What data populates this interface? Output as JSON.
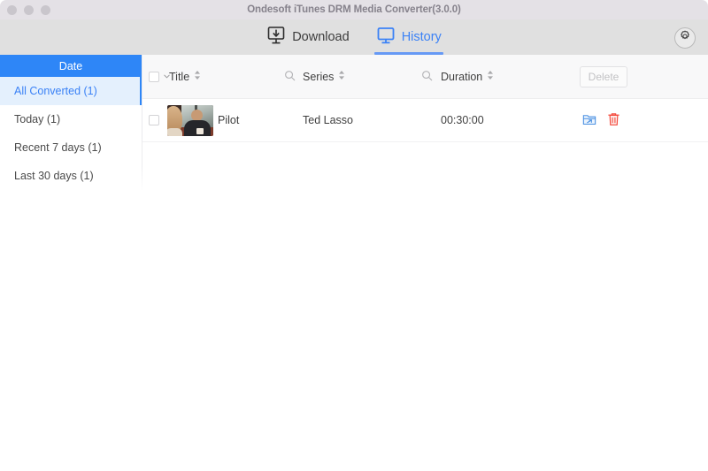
{
  "window": {
    "title": "Ondesoft iTunes DRM Media Converter(3.0.0)",
    "traffic_lights": [
      "close-button",
      "minimize-button",
      "maximize-button"
    ]
  },
  "toolbar": {
    "tabs": [
      {
        "label": "Download",
        "icon": "download-monitor-icon",
        "active": false
      },
      {
        "label": "History",
        "icon": "monitor-icon",
        "active": true
      }
    ],
    "settings_icon": "gear-icon"
  },
  "sidebar": {
    "header": "Date",
    "items": [
      {
        "label": "All Converted (1)",
        "selected": true
      },
      {
        "label": "Today (1)",
        "selected": false
      },
      {
        "label": "Recent 7 days (1)",
        "selected": false
      },
      {
        "label": "Last 30 days (1)",
        "selected": false
      }
    ]
  },
  "table": {
    "select_all_checkbox": false,
    "columns": [
      {
        "key": "title",
        "label": "Title",
        "sortable": true,
        "searchable": false
      },
      {
        "key": "series",
        "label": "Series",
        "sortable": true,
        "searchable": true
      },
      {
        "key": "duration",
        "label": "Duration",
        "sortable": true,
        "searchable": true
      }
    ],
    "delete_button": {
      "label": "Delete",
      "enabled": false
    },
    "search_icon": "search-icon",
    "sort_icon": "sort-arrows-icon",
    "dropdown_icon": "chevron-down-icon",
    "rows": [
      {
        "checked": false,
        "thumbnail": "video-thumbnail",
        "title": "Pilot",
        "series": "Ted Lasso",
        "duration": "00:30:00",
        "actions": [
          {
            "name": "reveal-in-folder-icon",
            "color": "#4a90e2"
          },
          {
            "name": "delete-row-icon",
            "color": "#f4483b"
          }
        ]
      }
    ]
  },
  "colors": {
    "accent": "#2e86f7",
    "tab_active": "#3b82f6",
    "selected_row_bg": "#e4f0fd",
    "titlebar_bg": "#e4e1e6",
    "toolbar_bg": "#e0e0e0",
    "header_bg": "#f8f8f9",
    "danger": "#f4483b"
  }
}
